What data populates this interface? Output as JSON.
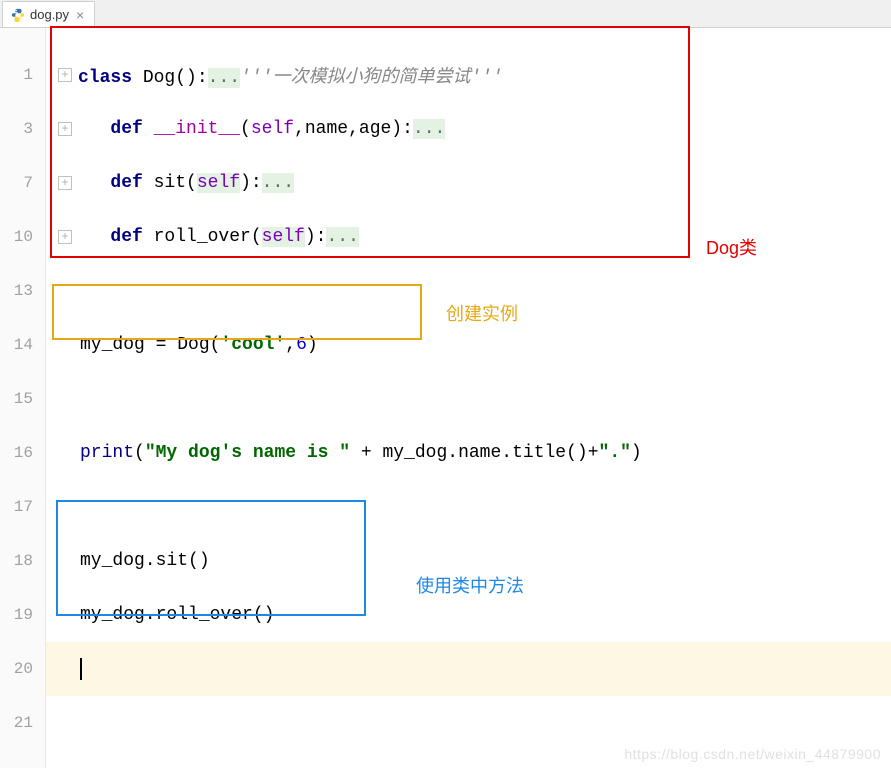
{
  "tab": {
    "title": "dog.py",
    "close": "×"
  },
  "line_numbers": [
    "1",
    "3",
    "7",
    "10",
    "13",
    "14",
    "15",
    "16",
    "17",
    "18",
    "19",
    "20",
    "21"
  ],
  "code": {
    "class_kw": "class",
    "class_name": " Dog():",
    "class_dots": "...",
    "docstring": "'''一次模拟小狗的简单尝试'''",
    "def_kw": "def",
    "init_name": "__init__",
    "init_params_open": "(",
    "self_param": "self",
    "init_rest": ",name,age):",
    "init_dots": "...",
    "sit_name": "sit",
    "sit_close": "):",
    "sit_dots": "...",
    "roll_name": "roll_over",
    "roll_close": "):",
    "roll_dots": "...",
    "inst_line_pre": "my_dog = Dog(",
    "inst_str": "'cool'",
    "inst_comma": ",",
    "inst_num": "6",
    "inst_close": ")",
    "print_fn": "print",
    "print_open": "(",
    "print_str1": "\"My dog's name is \"",
    "print_plus": " + my_dog.name.title()+",
    "print_str2": "\".\"",
    "print_close": ")",
    "call_sit": "my_dog.sit()",
    "call_roll": "my_dog.roll_over()"
  },
  "annotations": {
    "red_label": "Dog类",
    "orange_label": "创建实例",
    "blue_label": "使用类中方法",
    "colors": {
      "red": "#e30000",
      "orange": "#e6a817",
      "blue": "#1e88e5"
    }
  },
  "watermark": "https://blog.csdn.net/weixin_44879900"
}
